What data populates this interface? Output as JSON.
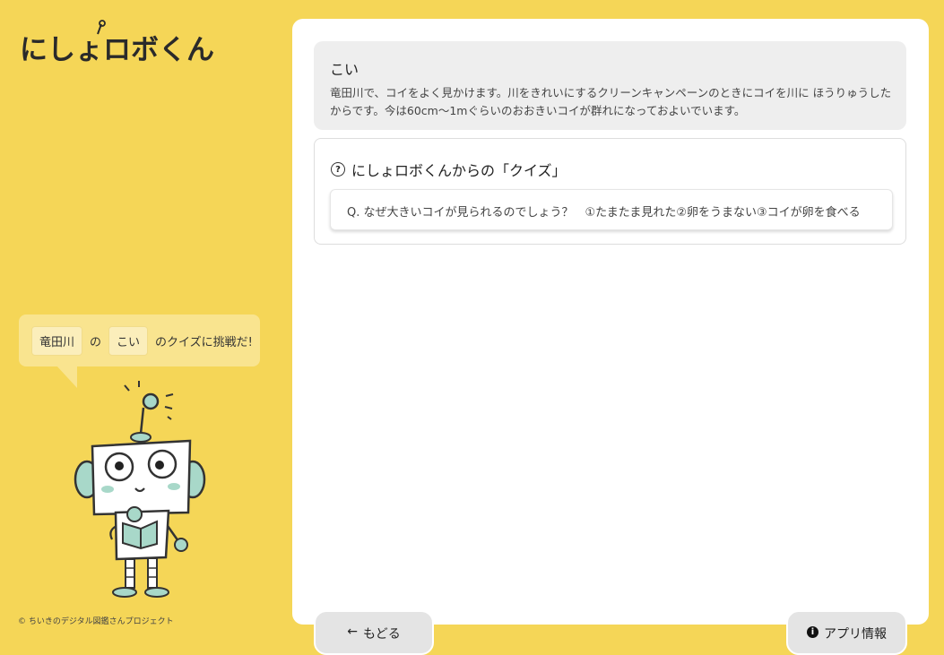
{
  "app": {
    "logo_text": "にしょロボくん",
    "copyright": "© ちいきのデジタル図鑑さんプロジェクト"
  },
  "bubble": {
    "river": "竜田川",
    "particle": "の",
    "fish": "こい",
    "suffix": "のクイズに挑戦だ!"
  },
  "info": {
    "title": "こい",
    "description": "竜田川で、コイをよく見かけます。川をきれいにするクリーンキャンペーンのときにコイを川に ほうりゅうしたからです。今は60cm～1mぐらいのおおきいコイが群れになっておよいでいます。"
  },
  "quiz": {
    "heading": "にしょロボくんからの「クイズ」",
    "question": "Q. なぜ大きいコイが見られるのでしょう？　①たまたま見れた②卵をうまない③コイが卵を食べる"
  },
  "buttons": {
    "back_label": "もどる",
    "back_arrow": "←",
    "info_label": "アプリ情報",
    "info_icon": "i"
  },
  "icons": {
    "help": "?"
  },
  "colors": {
    "background": "#f5d657",
    "panel": "#ffffff",
    "button": "#e4e4e4"
  }
}
